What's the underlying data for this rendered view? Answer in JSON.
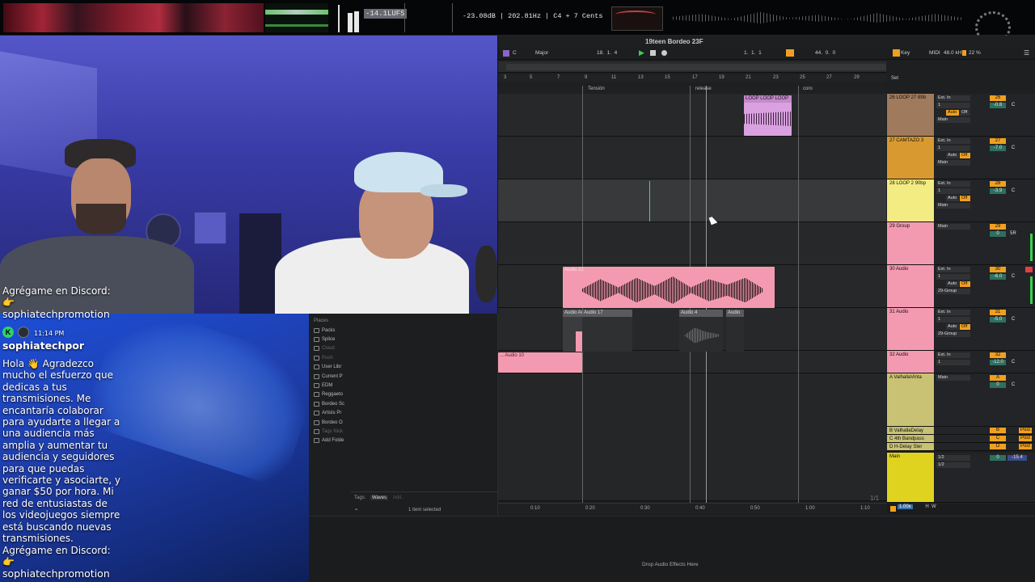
{
  "meters": {
    "lufs": "-14.1LUFS",
    "pitch_readout": "-23.08dB | 202.81Hz | C4 + 7 Cents"
  },
  "chat": {
    "top_line": "Agrégame en Discord:",
    "top_emoji": "👉",
    "top_user": "sophiatechpromotion",
    "time": "11:14 PM",
    "username": "sophiatechpor",
    "message": "Hola 👋 Agradezco mucho el esfuerzo que dedicas a tus transmisiones. Me encantaría colaborar para ayudarte a llegar a una audiencia más amplia y aumentar tu audiencia y seguidores para que puedas verificarte y asociarte, y ganar $50 por hora. Mi red de entusiastas de los videojuegos siempre está buscando nuevas transmisiones. Agrégame en Discord:",
    "msg_emoji": "👉",
    "msg_user": "sophiatechpromotion"
  },
  "browser": {
    "places_label": "Places",
    "items": [
      "Packs",
      "Splice",
      "Cloud",
      "Push",
      "User Libr",
      "Current P",
      "EDM",
      "Reggaeto",
      "Bordeo Sc",
      "Artists Pr",
      "Bordeo O",
      "Tags Nick",
      "Add Folde"
    ],
    "tags_label": "Tags:",
    "tag": "Waves",
    "tag_add": "Add..",
    "status": "1 item selected"
  },
  "daw": {
    "project_title": "19teen Bordeo 23F",
    "key": "C",
    "scale": "Major",
    "bar_pos": "18.  1.  4",
    "loop_pos": "1.  1.  1",
    "loop_len": "44.  0.  0",
    "key_label": "Key",
    "midi_label": "MIDI",
    "sample_rate": "48.0 kHz",
    "cpu": "22 %",
    "set_label": "Set",
    "ruler": [
      "3",
      "5",
      "7",
      "9",
      "11",
      "13",
      "15",
      "17",
      "19",
      "21",
      "23",
      "25",
      "27",
      "29"
    ],
    "locators": [
      "Tensión",
      "release",
      "coro"
    ],
    "time_ruler": [
      "0:10",
      "0:20",
      "0:30",
      "0:40",
      "0:50",
      "1:00",
      "1:10"
    ],
    "page_indicator": "1/1",
    "zoom": "1.00x",
    "tracks": [
      {
        "name": "26 LOOP 27 89b",
        "input": "Ext. In",
        "ch": "1",
        "num": "26",
        "vol": "-0.8",
        "pan": "C",
        "auto": "Auto",
        "off": "Off",
        "out": "Main"
      },
      {
        "name": "27 CAMTAZO 3",
        "input": "Ext. In",
        "ch": "1",
        "num": "27",
        "vol": "-7.0",
        "pan": "C",
        "auto": "Auto",
        "off": "Off",
        "out": "Main"
      },
      {
        "name": "28 LOOP 2 90bp",
        "input": "Ext. In",
        "ch": "1",
        "num": "28",
        "vol": "-3.9",
        "pan": "C",
        "auto": "Auto",
        "off": "Off",
        "out": "Main"
      },
      {
        "name": "29 Group",
        "input": "Main",
        "ch": "",
        "num": "29",
        "vol": "0",
        "pan": "5R",
        "auto": "",
        "off": "",
        "out": ""
      },
      {
        "name": "30 Audio",
        "input": "Ext. In",
        "ch": "1",
        "num": "30",
        "vol": "-6.0",
        "pan": "C",
        "auto": "Auto",
        "off": "Off",
        "out": "29-Group"
      },
      {
        "name": "31 Audio",
        "input": "Ext. In",
        "ch": "1",
        "num": "31",
        "vol": "-5.0",
        "pan": "C",
        "auto": "Auto",
        "off": "Off",
        "out": "29-Group"
      },
      {
        "name": "32 Audio",
        "input": "Ext. In",
        "ch": "1",
        "num": "32",
        "vol": "-12.0",
        "pan": "C",
        "auto": "",
        "off": "",
        "out": ""
      },
      {
        "name": "A ValhallaVinta",
        "input": "Main",
        "ch": "",
        "num": "A",
        "vol": "0",
        "pan": "C",
        "auto": "",
        "off": "",
        "out": ""
      }
    ],
    "returns": [
      {
        "name": "B ValhallaDelay",
        "num": "B",
        "post": "Post"
      },
      {
        "name": "C 4th Bandpass",
        "num": "C",
        "post": "Post"
      },
      {
        "name": "D H-Delay Ster",
        "num": "D",
        "post": "Post"
      }
    ],
    "main_track": {
      "name": "Main",
      "in1": "1/2",
      "in2": "1/2",
      "vol": "0",
      "pan": "-15.4"
    },
    "clips": {
      "loop": "LOOP LOOP LOOP",
      "audio21": "Audio 21",
      "audioA": "Audio Au",
      "audio17": "Audio 17",
      "audio4": "Audio 4",
      "audioX": "Audio",
      "audio10": "... Audio 10"
    },
    "drop_hint": "Drop Audio Effects Here",
    "extra_hw": "H  W"
  }
}
